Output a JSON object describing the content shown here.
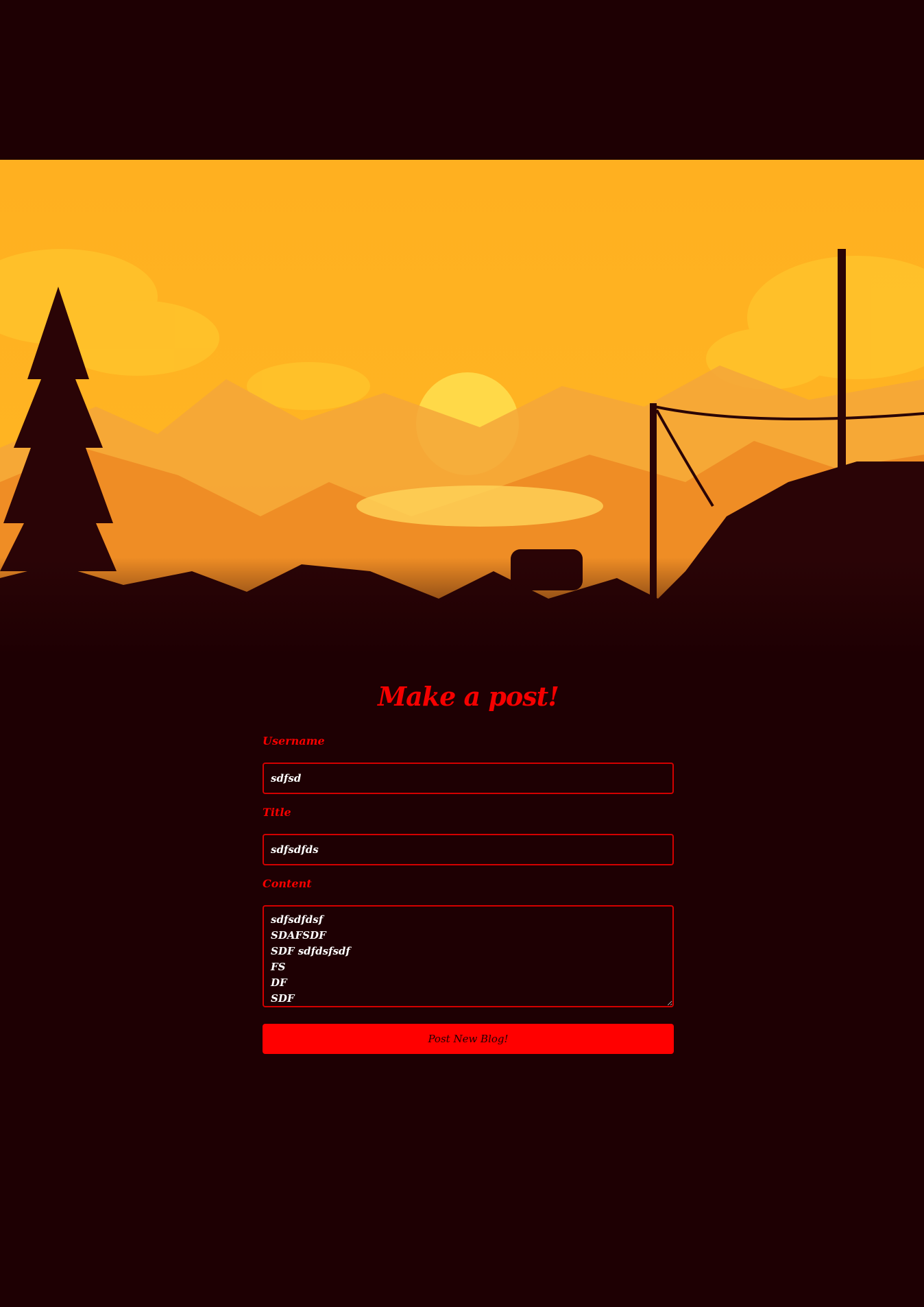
{
  "colors": {
    "background": "#1e0003",
    "accent": "#ff0000",
    "input_border": "#d30000",
    "input_text": "#ffffff",
    "sky": "#ffb321"
  },
  "hero": {
    "icon": "sunset-landscape-illustration"
  },
  "form": {
    "title": "Make a post!",
    "username_label": "Username",
    "username_value": "sdfsd",
    "title_label": "Title",
    "title_value": "sdfsdfds",
    "content_label": "Content",
    "content_value": "sdfsdfdsf\nSDAFSDF\nSDF sdfdsfsdf\nFS\nDF\nSDF",
    "submit_label": "Post New Blog!"
  }
}
